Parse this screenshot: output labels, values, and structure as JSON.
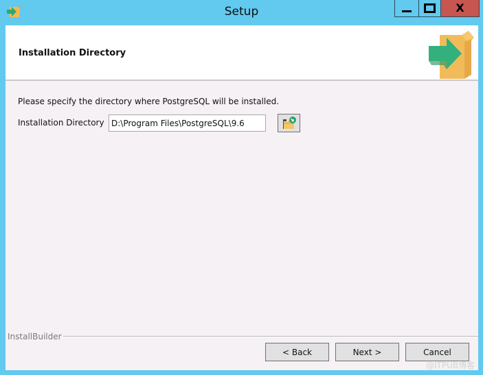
{
  "window": {
    "title": "Setup",
    "icons": {
      "app": "installer-box-arrow-icon",
      "minimize": "minimize-icon",
      "maximize": "maximize-icon",
      "close": "close-icon"
    },
    "close_glyph": "X",
    "colors": {
      "titlebar": "#62c9ef",
      "close_button": "#c75550",
      "body": "#f5f1f5"
    }
  },
  "header": {
    "title": "Installation Directory",
    "logo_icon": "installer-box-arrow-icon"
  },
  "content": {
    "prompt": "Please specify the directory where PostgreSQL will be installed.",
    "directory_label": "Installation Directory",
    "directory_value": "D:\\Program Files\\PostgreSQL\\9.6",
    "browse_icon": "folder-browse-icon"
  },
  "footer": {
    "brand": "InstallBuilder",
    "back_label": "< Back",
    "next_label": "Next >",
    "cancel_label": "Cancel"
  },
  "watermark": "@ITPUB博客"
}
